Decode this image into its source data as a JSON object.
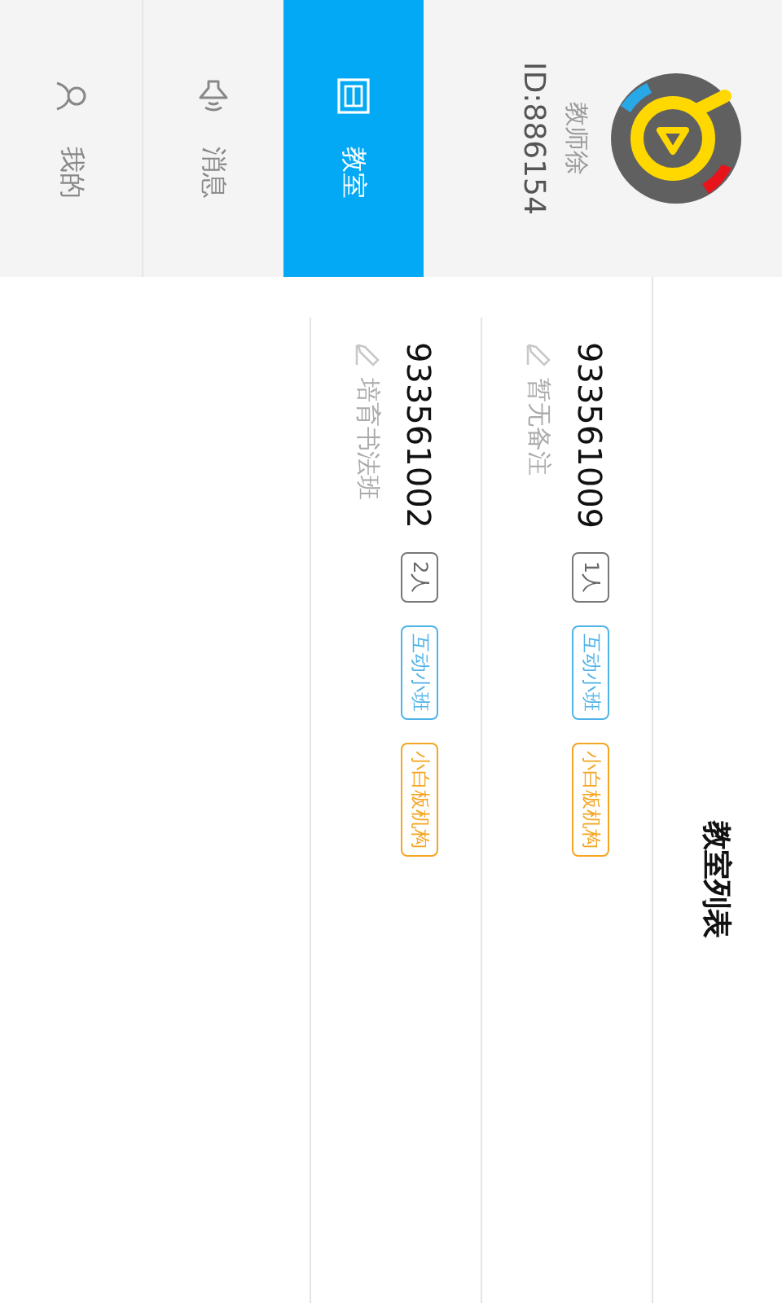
{
  "sidebar": {
    "user": {
      "name": "教师徐",
      "id": "ID:886154"
    },
    "tabs": [
      {
        "label": "教室",
        "selected": true
      },
      {
        "label": "消息",
        "selected": false
      },
      {
        "label": "我的",
        "selected": false
      }
    ]
  },
  "header": {
    "title": "教室列表"
  },
  "classrooms": [
    {
      "number": "933561009",
      "members": "1人",
      "tags": [
        {
          "label": "互动小班",
          "color": "#4fb3e8"
        },
        {
          "label": "小白板机构",
          "color": "#f5a623"
        }
      ],
      "note": "暂无备注"
    },
    {
      "number": "933561002",
      "members": "2人",
      "tags": [
        {
          "label": "互动小班",
          "color": "#4fb3e8"
        },
        {
          "label": "小白板机构",
          "color": "#f5a623"
        }
      ],
      "note": "培育书法班"
    }
  ]
}
